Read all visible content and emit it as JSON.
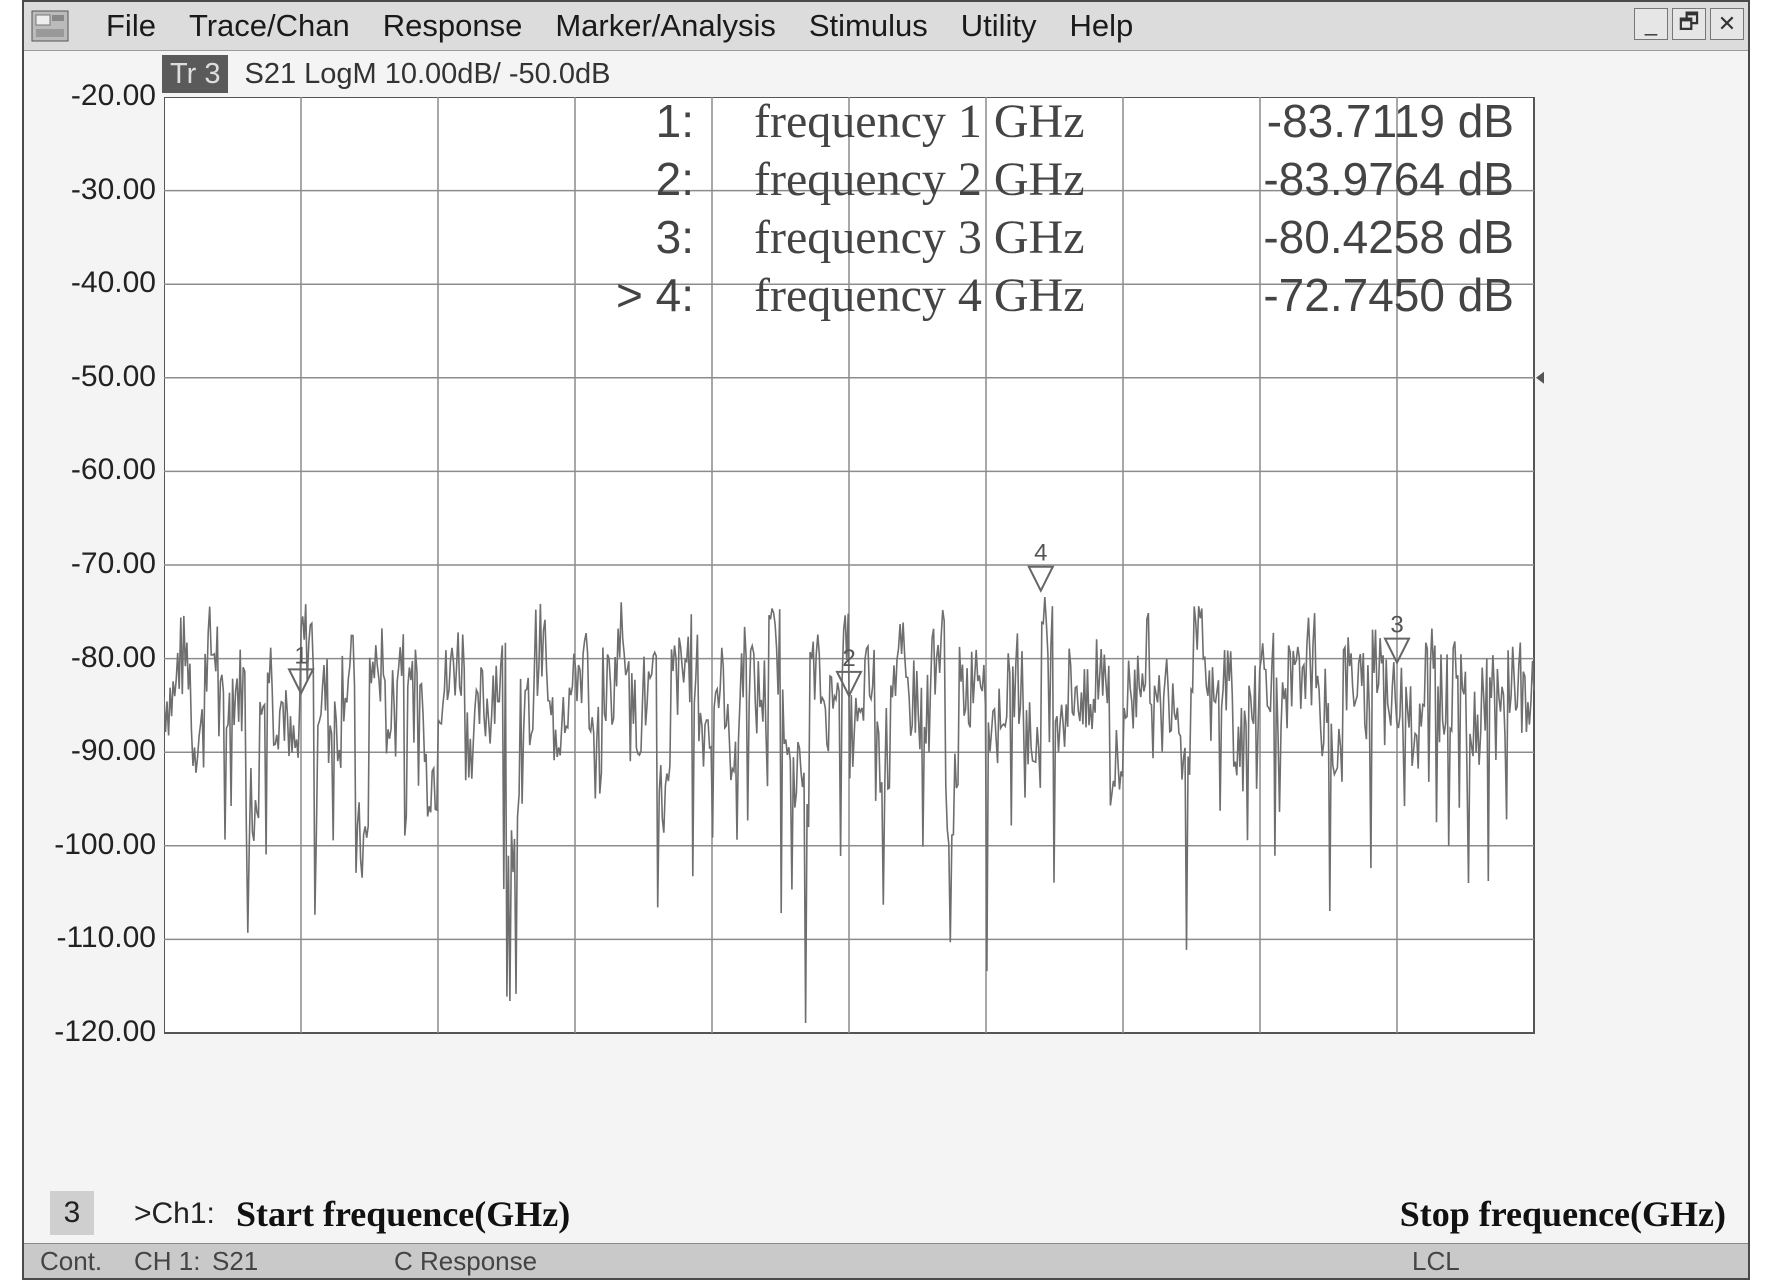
{
  "menubar": {
    "items": [
      "File",
      "Trace/Chan",
      "Response",
      "Marker/Analysis",
      "Stimulus",
      "Utility",
      "Help"
    ],
    "controls": [
      "_",
      "🗗",
      "✕"
    ]
  },
  "trace": {
    "badge": "Tr 3",
    "description": "S21 LogM 10.00dB/  -50.0dB"
  },
  "markers": [
    {
      "id": "1:",
      "label": "frequency 1  GHz",
      "value": "-83.7119 dB",
      "active": false
    },
    {
      "id": "2:",
      "label": "frequency 2  GHz",
      "value": "-83.9764 dB",
      "active": false
    },
    {
      "id": "3:",
      "label": "frequency 3  GHz",
      "value": "-80.4258 dB",
      "active": false
    },
    {
      "id": "> 4:",
      "label": "frequency 4  GHz",
      "value": "-72.7450 dB",
      "active": true
    }
  ],
  "chart_data": {
    "type": "line",
    "ylim": [
      -120,
      -20
    ],
    "yticks": [
      "-20.00",
      "-30.00",
      "-40.00",
      "-50.00",
      "-60.00",
      "-70.00",
      "-80.00",
      "-90.00",
      "-100.00",
      "-110.00",
      "-120.00"
    ],
    "reference_level": -50,
    "x_divisions": 10,
    "noise_floor_mean": -82,
    "series": [
      {
        "values": [
          -84,
          -80,
          -88,
          -79,
          -86,
          -83,
          -95,
          -81,
          -85,
          -90,
          -78,
          -84,
          -87,
          -82,
          -100,
          -81,
          -86,
          -79,
          -84,
          -92,
          -83,
          -80,
          -88,
          -85,
          -82,
          -99,
          -86,
          -79,
          -87,
          -84,
          -81,
          -90,
          -83,
          -78,
          -86,
          -84,
          -95,
          -82,
          -80,
          -87,
          -83,
          -89,
          -81,
          -84,
          -79,
          -86,
          -93,
          -82,
          -85,
          -80,
          -88,
          -83,
          -90,
          -81,
          -84,
          -86,
          -79,
          -95,
          -83,
          -80,
          -87,
          -84,
          -82,
          -89,
          -78,
          -85,
          -83,
          -86,
          -81,
          -92,
          -84,
          -80,
          -86,
          -83,
          -88,
          -79,
          -85,
          -82,
          -90,
          -84,
          -81,
          -87,
          -83,
          -80,
          -86,
          -89,
          -82,
          -84,
          -79,
          -85,
          -83,
          -88,
          -81,
          -84,
          -80,
          -87,
          -83,
          -86,
          -82,
          -85
        ]
      }
    ],
    "markers": [
      {
        "n": "1",
        "x_frac": 0.1,
        "y": -83.7119
      },
      {
        "n": "2",
        "x_frac": 0.5,
        "y": -83.9764
      },
      {
        "n": "3",
        "x_frac": 0.9,
        "y": -80.4258
      },
      {
        "n": "4",
        "x_frac": 0.64,
        "y": -72.745
      }
    ]
  },
  "axis": {
    "channel_box": "3",
    "channel_prefix": ">Ch1:",
    "start_label": "Start frequence(GHz)",
    "stop_label": "Stop frequence(GHz)"
  },
  "status": {
    "mode": "Cont.",
    "channel": "CH 1:",
    "param": "S21",
    "cal": "C  Response",
    "remote": "LCL"
  }
}
